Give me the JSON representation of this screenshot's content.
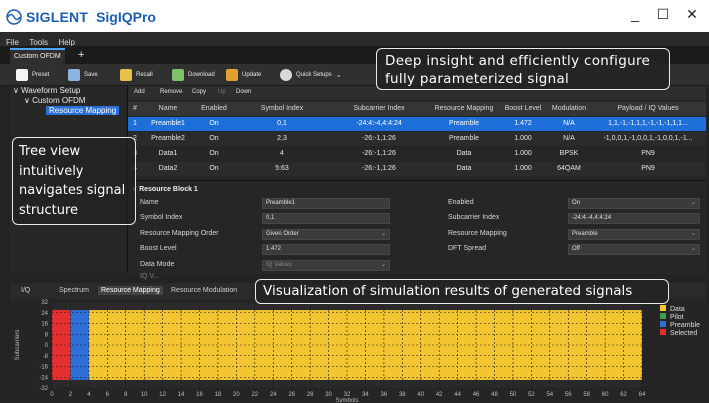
{
  "app": {
    "brand": "SIGLENT",
    "name": "SigIQPro"
  },
  "window_controls": {
    "minimize": "_",
    "maximize": "☐",
    "close": "✕"
  },
  "menu": [
    "File",
    "Tools",
    "Help"
  ],
  "doc_tab": {
    "label": "Custom OFDM",
    "plus": "+"
  },
  "toolbar": {
    "preset": "Preset",
    "save": "Save",
    "recall": "Recall",
    "download": "Download",
    "update": "Update",
    "quick_setups": "Quick Setups"
  },
  "tree": {
    "root": "Waveform Setup",
    "child": "Custom OFDM",
    "leaf": "Resource Mapping"
  },
  "table_toolbar": {
    "add": "Add",
    "remove": "Remove",
    "copy": "Copy",
    "up": "Up",
    "down": "Down"
  },
  "table": {
    "headers": [
      "#",
      "Name",
      "Enabled",
      "Symbol Index",
      "Subcarrier Index",
      "Resource Mapping",
      "Boost Level",
      "Modulation",
      "Payload / IQ Values"
    ],
    "rows": [
      [
        "1",
        "Preamble1",
        "On",
        "0,1",
        "-24:4:-4,4:4:24",
        "Preamble",
        "1.472",
        "N/A",
        "1,1,-1,-1,1,1,-1,-1,-1,1,1..."
      ],
      [
        "2",
        "Preamble2",
        "On",
        "2,3",
        "-26:-1,1:26",
        "Preamble",
        "1.000",
        "N/A",
        "-1,0,0,1,-1,0,0,1,-1,0,0,1,-1..."
      ],
      [
        "3",
        "Data1",
        "On",
        "4",
        "-26:-1,1:26",
        "Data",
        "1.000",
        "BPSK",
        "PN9"
      ],
      [
        "4",
        "Data2",
        "On",
        "5:63",
        "-26:-1,1:26",
        "Data",
        "1.000",
        "64QAM",
        "PN9"
      ]
    ]
  },
  "resource_block": {
    "title": "Resource Block 1",
    "name_label": "Name",
    "name_value": "Preamble1",
    "symbol_index_label": "Symbol Index",
    "symbol_index_value": "0,1",
    "rm_order_label": "Resource Mapping Order",
    "rm_order_value": "Given Order",
    "boost_label": "Boost Level",
    "boost_value": "1.472",
    "data_mode_label": "Data Mode",
    "data_mode_value": "IQ Values",
    "enabled_label": "Enabled",
    "enabled_value": "On",
    "subcarrier_label": "Subcarrier Index",
    "subcarrier_value": "-24:4:-4,4:4:24",
    "rm_label": "Resource Mapping",
    "rm_value": "Preamble",
    "dft_label": "DFT Spread",
    "dft_value": "Off",
    "cut_label": "IQ V..."
  },
  "bottom_tabs": [
    "I/Q",
    "Spectrum",
    "Resource Mapping",
    "Resource Modulation"
  ],
  "callouts": {
    "top": "Deep insight and efficiently configure fully parameterized signal",
    "left": "Tree view intuitively navigates signal structure",
    "bottom": "Visualization of simulation results of generated signals"
  },
  "colors": {
    "data": "#f2c531",
    "pilot": "#3aa04a",
    "preamble": "#2f6fd8",
    "selected": "#e53030",
    "accent": "#1e6fd9"
  },
  "chart_data": {
    "type": "heatmap",
    "xlabel": "Symbols",
    "ylabel": "Subcarriers",
    "xlim": [
      0,
      64
    ],
    "ylim": [
      -32,
      32
    ],
    "x_ticks": [
      0,
      2,
      4,
      6,
      8,
      10,
      12,
      14,
      16,
      18,
      20,
      22,
      24,
      26,
      28,
      30,
      32,
      34,
      36,
      38,
      40,
      42,
      44,
      46,
      48,
      50,
      52,
      54,
      56,
      58,
      60,
      62,
      64
    ],
    "y_ticks": [
      32,
      24,
      16,
      8,
      0,
      -8,
      -16,
      -24,
      -32
    ],
    "legend": [
      {
        "name": "Data",
        "color": "#f2c531"
      },
      {
        "name": "Pilot",
        "color": "#3aa04a"
      },
      {
        "name": "Preamble",
        "color": "#2f6fd8"
      },
      {
        "name": "Selected",
        "color": "#e53030"
      }
    ],
    "regions": [
      {
        "type": "Selected",
        "x": [
          0,
          2
        ],
        "y": [
          -26,
          26
        ]
      },
      {
        "type": "Preamble",
        "x": [
          2,
          4
        ],
        "y": [
          -26,
          26
        ]
      },
      {
        "type": "Data",
        "x": [
          4,
          64
        ],
        "y": [
          -26,
          26
        ]
      }
    ]
  }
}
